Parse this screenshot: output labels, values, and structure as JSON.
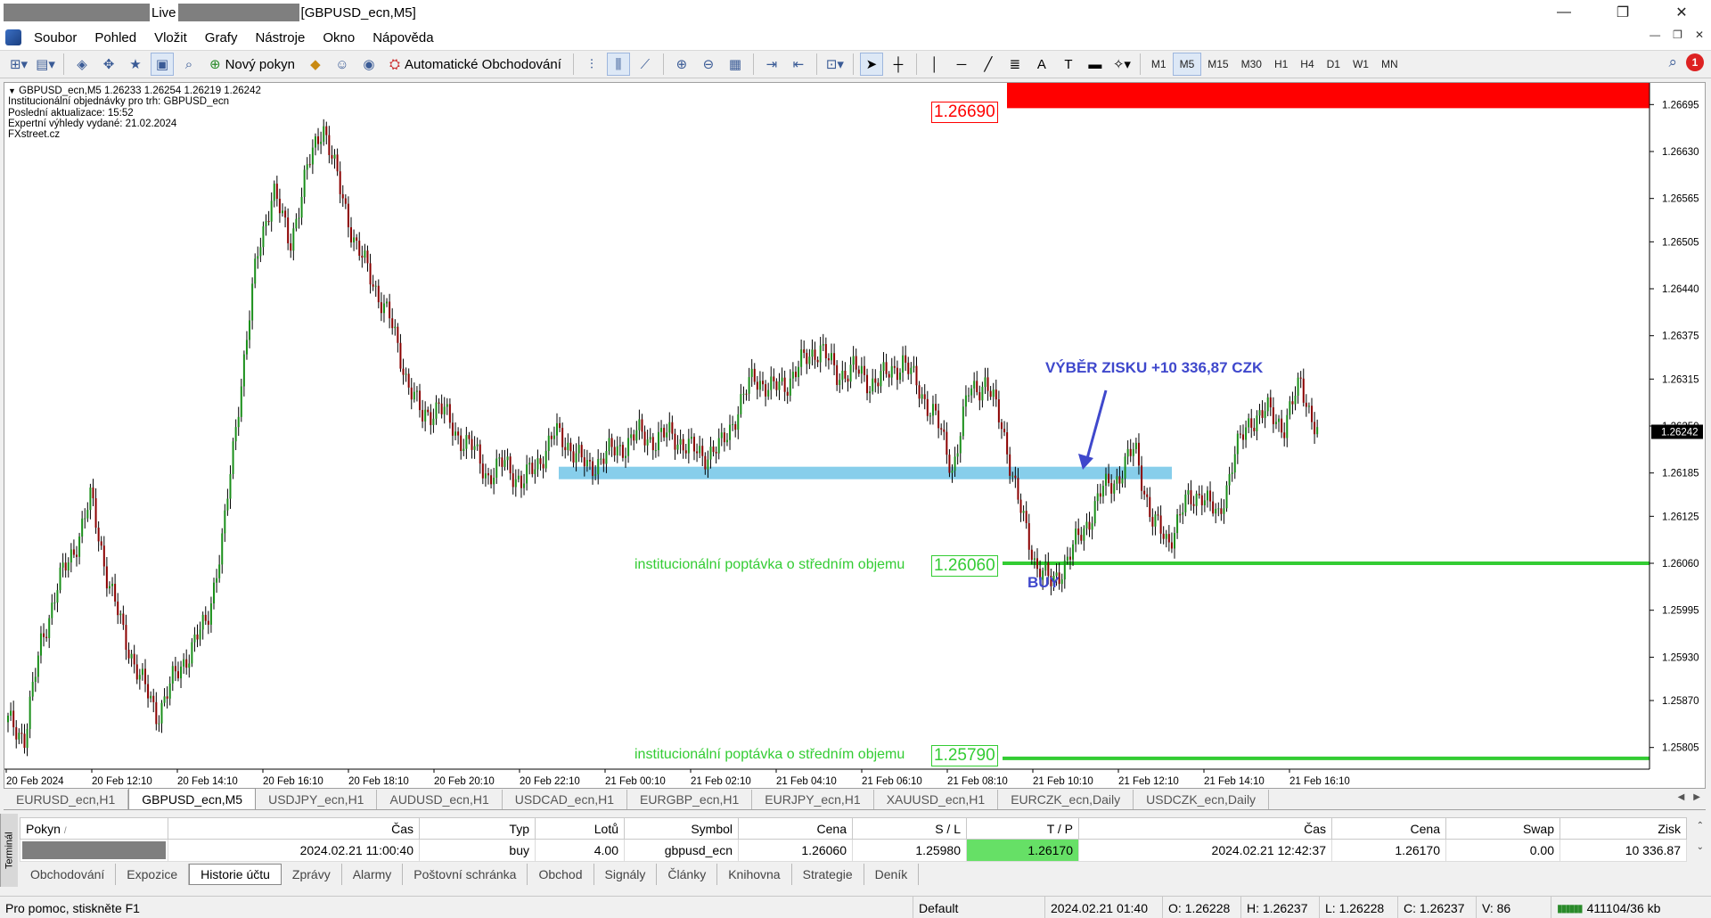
{
  "window": {
    "title_live": "Live",
    "title_chart": "[GBPUSD_ecn,M5]",
    "minimize": "—",
    "maximize": "❐",
    "close": "✕"
  },
  "menu": [
    "Soubor",
    "Pohled",
    "Vložit",
    "Grafy",
    "Nástroje",
    "Okno",
    "Nápověda"
  ],
  "toolbar": {
    "new_order": "Nový pokyn",
    "auto_trading": "Automatické Obchodování",
    "timeframes": [
      "M1",
      "M5",
      "M15",
      "M30",
      "H1",
      "H4",
      "D1",
      "W1",
      "MN"
    ],
    "active_timeframe": "M5",
    "notifications": "1"
  },
  "chart": {
    "header": "GBPUSD_ecn,M5  1.26233 1.26254 1.26219 1.26242",
    "info_lines": [
      "Institucionální objednávky pro trh: GBPUSD_ecn",
      "Poslední aktualizace: 15:52",
      "Expertní výhledy vydané: 21.02.2024",
      "FXstreet.cz"
    ],
    "zones": {
      "supply_price": "1.26690",
      "demand_mid_label": "institucionální poptávka o středním objemu",
      "demand_mid_price": "1.26060",
      "demand_low_label": "institucionální poptávka o středním objemu",
      "demand_low_price": "1.25790"
    },
    "annotations": {
      "profit": "VÝBĚR ZISKU +10 336,87 CZK",
      "buy": "BUY"
    },
    "current_price": "1.26242",
    "colors": {
      "bull": "#1a8f1a",
      "bear": "#8b0000",
      "supply": "#ff0000",
      "demand": "#33cc33",
      "level": "#87ceeb",
      "annotation": "#3f48cc"
    }
  },
  "chart_data": {
    "type": "candlestick",
    "symbol": "GBPUSD_ecn",
    "timeframe": "M5",
    "y_ticks": [
      "1.26695",
      "1.26630",
      "1.26565",
      "1.26505",
      "1.26440",
      "1.26375",
      "1.26315",
      "1.26250",
      "1.26185",
      "1.26125",
      "1.26060",
      "1.25995",
      "1.25930",
      "1.25870",
      "1.25805"
    ],
    "x_ticks": [
      "20 Feb 2024",
      "20 Feb 12:10",
      "20 Feb 14:10",
      "20 Feb 16:10",
      "20 Feb 18:10",
      "20 Feb 20:10",
      "20 Feb 22:10",
      "21 Feb 00:10",
      "21 Feb 02:10",
      "21 Feb 04:10",
      "21 Feb 06:10",
      "21 Feb 08:10",
      "21 Feb 10:10",
      "21 Feb 12:10",
      "21 Feb 14:10",
      "21 Feb 16:10"
    ],
    "ylim": [
      1.25775,
      1.26725
    ],
    "close_path": [
      [
        0,
        1.2584
      ],
      [
        3,
        1.2582
      ],
      [
        6,
        1.2595
      ],
      [
        9,
        1.2603
      ],
      [
        12,
        1.2608
      ],
      [
        15,
        1.2615
      ],
      [
        18,
        1.2604
      ],
      [
        21,
        1.2596
      ],
      [
        24,
        1.259
      ],
      [
        27,
        1.2585
      ],
      [
        30,
        1.259
      ],
      [
        33,
        1.2594
      ],
      [
        36,
        1.2598
      ],
      [
        39,
        1.261
      ],
      [
        42,
        1.263
      ],
      [
        45,
        1.2648
      ],
      [
        48,
        1.2658
      ],
      [
        51,
        1.265
      ],
      [
        54,
        1.266
      ],
      [
        57,
        1.2667
      ],
      [
        60,
        1.2658
      ],
      [
        63,
        1.265
      ],
      [
        66,
        1.2645
      ],
      [
        69,
        1.264
      ],
      [
        72,
        1.2632
      ],
      [
        75,
        1.2626
      ],
      [
        78,
        1.2628
      ],
      [
        81,
        1.2624
      ],
      [
        84,
        1.2622
      ],
      [
        87,
        1.2618
      ],
      [
        90,
        1.262
      ],
      [
        93,
        1.2617
      ],
      [
        96,
        1.262
      ],
      [
        99,
        1.2624
      ],
      [
        102,
        1.2622
      ],
      [
        105,
        1.2619
      ],
      [
        108,
        1.2621
      ],
      [
        111,
        1.2622
      ],
      [
        114,
        1.2624
      ],
      [
        117,
        1.2623
      ],
      [
        120,
        1.2624
      ],
      [
        123,
        1.2622
      ],
      [
        126,
        1.2621
      ],
      [
        129,
        1.2622
      ],
      [
        132,
        1.2627
      ],
      [
        135,
        1.2632
      ],
      [
        138,
        1.263
      ],
      [
        141,
        1.2631
      ],
      [
        144,
        1.2634
      ],
      [
        147,
        1.2636
      ],
      [
        150,
        1.2632
      ],
      [
        153,
        1.2633
      ],
      [
        156,
        1.2631
      ],
      [
        159,
        1.2632
      ],
      [
        162,
        1.2634
      ],
      [
        165,
        1.263
      ],
      [
        168,
        1.2626
      ],
      [
        171,
        1.2619
      ],
      [
        174,
        1.263
      ],
      [
        177,
        1.2631
      ],
      [
        180,
        1.2625
      ],
      [
        183,
        1.2614
      ],
      [
        186,
        1.2606
      ],
      [
        189,
        1.2603
      ],
      [
        192,
        1.2607
      ],
      [
        195,
        1.2611
      ],
      [
        198,
        1.2616
      ],
      [
        201,
        1.2618
      ],
      [
        204,
        1.2622
      ],
      [
        207,
        1.2612
      ],
      [
        210,
        1.2609
      ],
      [
        213,
        1.2614
      ],
      [
        216,
        1.2616
      ],
      [
        219,
        1.2612
      ],
      [
        222,
        1.2621
      ],
      [
        225,
        1.2626
      ],
      [
        228,
        1.2627
      ],
      [
        231,
        1.2625
      ],
      [
        234,
        1.2631
      ],
      [
        237,
        1.2624
      ]
    ]
  },
  "symbol_tabs": [
    "EURUSD_ecn,H1",
    "GBPUSD_ecn,M5",
    "USDJPY_ecn,H1",
    "AUDUSD_ecn,H1",
    "USDCAD_ecn,H1",
    "EURGBP_ecn,H1",
    "EURJPY_ecn,H1",
    "XAUUSD_ecn,H1",
    "EURCZK_ecn,Daily",
    "USDCZK_ecn,Daily"
  ],
  "active_symbol_tab": "GBPUSD_ecn,M5",
  "terminal": {
    "side_label": "Terminál",
    "columns": [
      "Pokyn",
      "Čas",
      "Typ",
      "Lotů",
      "Symbol",
      "Cena",
      "S / L",
      "T / P",
      "Čas",
      "Cena",
      "Swap",
      "Zisk"
    ],
    "row": {
      "open_time": "2024.02.21 11:00:40",
      "type": "buy",
      "lots": "4.00",
      "symbol": "gbpusd_ecn",
      "price": "1.26060",
      "sl": "1.25980",
      "tp": "1.26170",
      "close_time": "2024.02.21 12:42:37",
      "close_price": "1.26170",
      "swap": "0.00",
      "profit": "10 336.87"
    },
    "tabs": [
      "Obchodování",
      "Expozice",
      "Historie účtu",
      "Zprávy",
      "Alarmy",
      "Poštovní schránka",
      "Obchod",
      "Signály",
      "Články",
      "Knihovna",
      "Strategie",
      "Deník"
    ],
    "active_tab": "Historie účtu"
  },
  "status": {
    "help": "Pro pomoc, stiskněte F1",
    "profile": "Default",
    "datetime": "2024.02.21 01:40",
    "open": "O: 1.26228",
    "high": "H: 1.26237",
    "low": "L: 1.26228",
    "close": "C: 1.26237",
    "volume": "V: 86",
    "traffic": "411104/36 kb"
  }
}
